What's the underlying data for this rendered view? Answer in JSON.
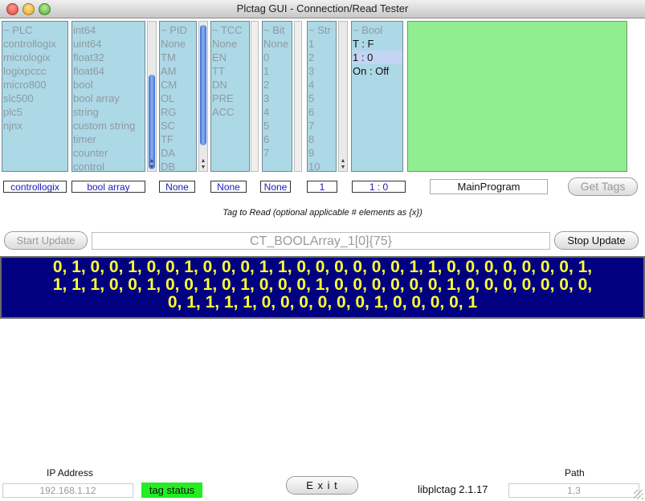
{
  "window": {
    "title": "Plctag GUI - Connection/Read Tester"
  },
  "lists": {
    "plc": [
      "~ PLC",
      "controllogix",
      "micrologix",
      "logixpccc",
      "micro800",
      "slc500",
      "plc5",
      "njnx"
    ],
    "types": [
      "int64",
      "uint64",
      "float32",
      "float64",
      "bool",
      "bool array",
      "string",
      "custom string",
      "timer",
      "counter",
      "control"
    ],
    "pid": [
      "~ PID",
      "None",
      "TM",
      "AM",
      "CM",
      "OL",
      "RG",
      "SC",
      "TF",
      "DA",
      "DB"
    ],
    "tcc": [
      "~ TCC",
      "None",
      "EN",
      "TT",
      "DN",
      "PRE",
      "ACC"
    ],
    "bit": [
      "~ Bit",
      "None",
      "0",
      "1",
      "2",
      "3",
      "4",
      "5",
      "6",
      "7"
    ],
    "str": [
      "~ Str",
      "1",
      "2",
      "3",
      "4",
      "5",
      "6",
      "7",
      "8",
      "9",
      "10"
    ],
    "bool": [
      "~ Bool",
      "T : F",
      "1 : 0",
      "On : Off"
    ]
  },
  "selected": {
    "plc": "controllogix",
    "type": "bool array",
    "pid": "None",
    "tcc": "None",
    "bit": "None",
    "str": "1",
    "bool": "1 : 0"
  },
  "program": "MainProgram",
  "buttons": {
    "get_tags": "Get Tags",
    "start_update": "Start Update",
    "stop_update": "Stop Update",
    "exit": "E x i t"
  },
  "hint": "Tag to Read (optional applicable # elements as {x})",
  "tag_input": "CT_BOOLArray_1[0]{75}",
  "output_lines": [
    "0, 1, 0, 0, 1, 0, 0, 1, 0, 0, 0, 1, 1, 0, 0, 0, 0, 0, 0, 1, 1, 0, 0, 0, 0, 0, 0, 0, 1,",
    "1, 1, 1, 0, 0, 1, 0, 0, 1, 0, 1, 0, 0, 0, 1, 0, 0, 0, 0, 0, 0, 1, 0, 0, 0, 0, 0, 0, 0,",
    "0, 1, 1, 1, 1, 0, 0, 0, 0, 0, 0, 1, 0, 0, 0, 0, 1"
  ],
  "footer": {
    "ip_label": "IP Address",
    "ip_value": "192.168.1.12",
    "tag_status": "tag status",
    "version": "libplctag 2.1.17",
    "path_label": "Path",
    "path_value": "1,3"
  },
  "colors": {
    "list_bg": "#add8e6",
    "green_panel": "#90ee90",
    "output_bg": "#000080",
    "output_text": "#ffff33",
    "status_green": "#22ee22",
    "label_blue": "#1a1ab8"
  }
}
